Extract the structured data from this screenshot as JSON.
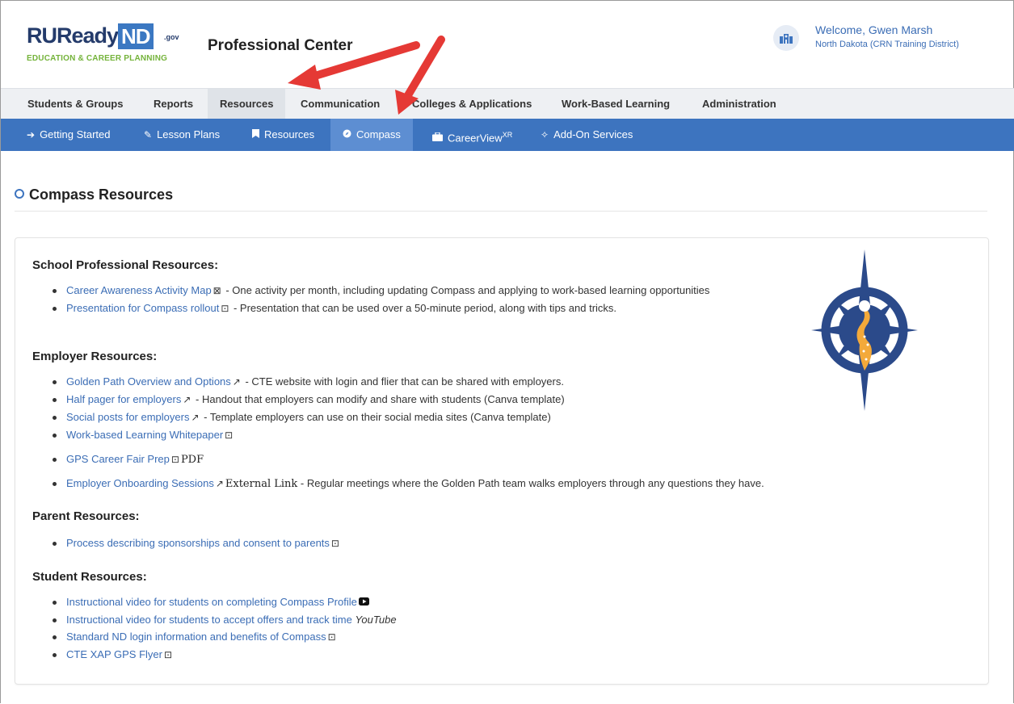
{
  "header": {
    "logo_ru": "RUReady",
    "logo_nd": "ND",
    "logo_gov": ".gov",
    "logo_tagline": "EDUCATION & CAREER PLANNING",
    "app_title": "Professional Center",
    "welcome": "Welcome, Gwen Marsh",
    "district": "North Dakota (CRN Training District)"
  },
  "topnav": [
    "Students & Groups",
    "Reports",
    "Resources",
    "Communication",
    "Colleges & Applications",
    "Work-Based Learning",
    "Administration"
  ],
  "subnav": {
    "getting_started": "Getting Started",
    "lesson_plans": "Lesson Plans",
    "resources": "Resources",
    "compass": "Compass",
    "careerview": "CareerView",
    "careerview_sup": "XR",
    "addon": "Add-On Services"
  },
  "page": {
    "title": "Compass Resources"
  },
  "sections": {
    "school": {
      "heading": "School Professional Resources:",
      "items": [
        {
          "link": "Career Awareness Activity Map",
          "desc": " - One activity per month, including updating Compass and applying to work-based learning opportunities"
        },
        {
          "link": "Presentation for Compass rollout",
          "desc": " - Presentation that can be used over a 50-minute period, along with tips and tricks."
        }
      ]
    },
    "employer": {
      "heading": "Employer Resources:",
      "items": [
        {
          "link": "Golden Path Overview and Options",
          "desc": " - CTE website with login and flier that can be shared with employers."
        },
        {
          "link": "Half pager for employers",
          "desc": " - Handout that employers can modify and share with students (Canva template)"
        },
        {
          "link": "Social posts for employers",
          "desc": " - Template employers can use on their social media sites (Canva template)"
        },
        {
          "link": "Work-based Learning Whitepaper",
          "desc": ""
        },
        {
          "link": "GPS Career Fair Prep",
          "desc": "PDF"
        },
        {
          "link": "Employer Onboarding Sessions",
          "extlabel": "External Link",
          "desc": " - Regular meetings where the Golden Path team walks employers through any questions they have."
        }
      ]
    },
    "parent": {
      "heading": "Parent Resources:",
      "items": [
        {
          "link": "Process describing sponsorships and consent to parents"
        }
      ]
    },
    "student": {
      "heading": "Student Resources:",
      "items": [
        {
          "link": "Instructional video for students on completing Compass Profile"
        },
        {
          "link": "Instructional video for students to accept offers and track time",
          "desc": "YouTube"
        },
        {
          "link": "Standard ND login information and benefits of Compass"
        },
        {
          "link": "CTE XAP GPS Flyer"
        }
      ]
    }
  },
  "colors": {
    "brand_blue": "#3d74bf",
    "link": "#3b6db5",
    "arrow": "#e53935",
    "logo_green": "#74b33a"
  }
}
